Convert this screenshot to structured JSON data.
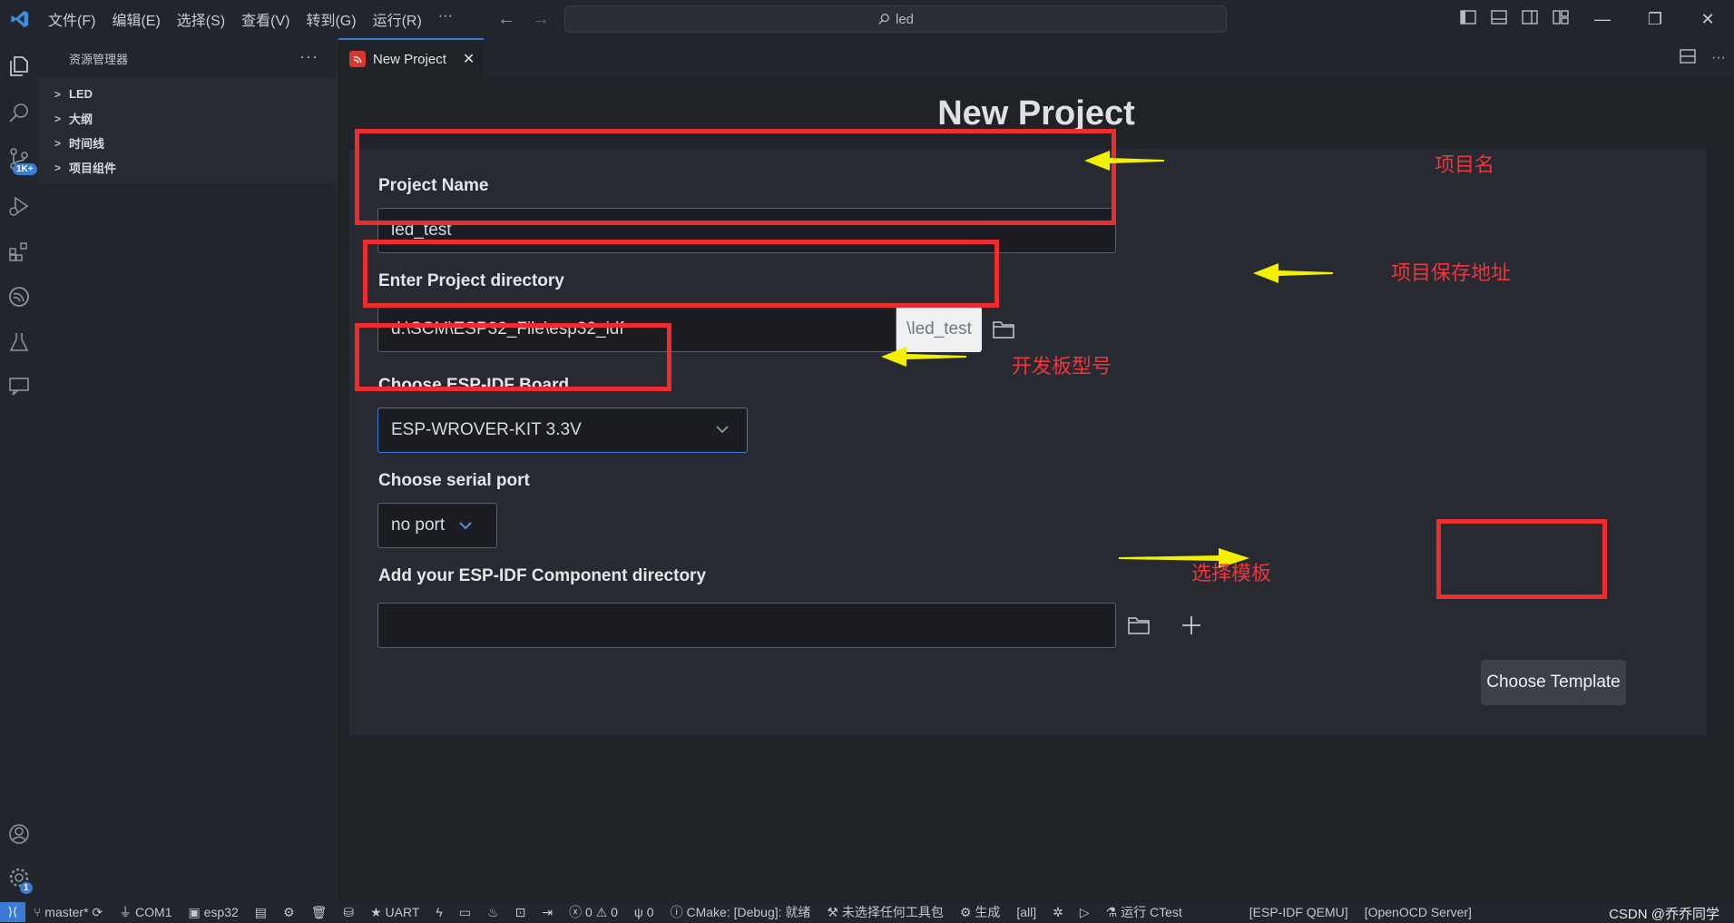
{
  "menu": [
    "文件(F)",
    "编辑(E)",
    "选择(S)",
    "查看(V)",
    "转到(G)",
    "运行(R)",
    "···"
  ],
  "search": {
    "text": "led"
  },
  "sidebar": {
    "title": "资源管理器",
    "items": [
      {
        "label": "LED"
      },
      {
        "label": "大纲"
      },
      {
        "label": "时间线"
      },
      {
        "label": "项目组件"
      }
    ]
  },
  "activity": {
    "scm_badge": "1K+",
    "settings_badge": "1"
  },
  "tab": {
    "label": "New Project"
  },
  "form": {
    "title": "New Project",
    "project_name_label": "Project Name",
    "project_name_value": "led_test",
    "directory_label": "Enter Project directory",
    "directory_value": "d:\\SCM\\ESP32_File\\esp32_idf",
    "directory_suffix": "\\led_test",
    "board_label": "Choose ESP-IDF Board",
    "board_value": "ESP-WROVER-KIT 3.3V",
    "port_label": "Choose serial port",
    "port_value": "no port",
    "component_label": "Add your ESP-IDF Component directory",
    "component_value": "",
    "choose_template_button": "Choose Template"
  },
  "annotations": {
    "project_name": "项目名",
    "project_dir": "项目保存地址",
    "board": "开发板型号",
    "template": "选择模板"
  },
  "annotation_colors": {
    "box": "#ee2c2f",
    "arrow": "#f5f000"
  },
  "statusbar": {
    "branch": "master*",
    "com": "COM1",
    "target": "esp32",
    "uart": "UART",
    "errors": "0",
    "warnings": "0",
    "ports": "0",
    "cmake": "CMake: [Debug]: 就绪",
    "kit": "未选择任何工具包",
    "build": "生成",
    "all": "[all]",
    "ctest": "运行 CTest",
    "qemu": "[ESP-IDF QEMU]",
    "openocd": "[OpenOCD Server]",
    "watermark": "CSDN @乔乔同学"
  }
}
